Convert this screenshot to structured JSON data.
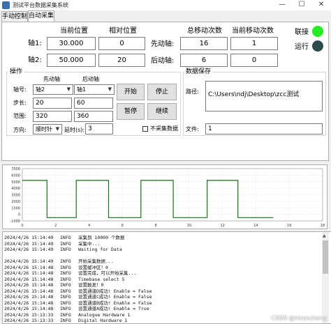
{
  "window": {
    "title": "测试平台数据采集系统",
    "minimize": "—",
    "maximize": "☐",
    "close": "✕"
  },
  "tabs": [
    {
      "label": "手动控制"
    },
    {
      "label": "自动采集"
    }
  ],
  "headers": {
    "current_pos": "当前位置",
    "relative_pos": "相对位置",
    "total_moves": "总移动次数",
    "current_moves": "当前移动次数"
  },
  "axis1": {
    "label": "轴1:",
    "current": "30.000",
    "relative": "0",
    "move_label": "先动轴:",
    "total": "16",
    "current_moves": "1"
  },
  "axis2": {
    "label": "轴2:",
    "current": "50.000",
    "relative": "20",
    "move_label": "后动轴:",
    "total": "6",
    "current_moves": "0"
  },
  "status": {
    "connect_label": "联接",
    "connect_color": "#22ee22",
    "run_label": "运行",
    "run_color": "#2b4a4a"
  },
  "operation": {
    "title": "操作",
    "col_first": "先动轴",
    "col_second": "后动轴",
    "axis_label": "轴号:",
    "axis_first": "轴2",
    "axis_second": "轴1",
    "step_label": "步长:",
    "step_first": "20",
    "step_second": "60",
    "range_label": "范围:",
    "range_first": "320",
    "range_second": "360",
    "dir_label": "方向:",
    "dir_value": "顺时针",
    "delay_label": "延时(s):",
    "delay_value": "3",
    "start": "开始",
    "stop": "停止",
    "pause": "暂停",
    "resume": "继续",
    "no_collect": "不采集数据"
  },
  "save": {
    "title": "数据保存",
    "path_label": "路径:",
    "path_value": "C:\\Users\\ndj\\Desktop\\zcc测试",
    "file_label": "文件:",
    "file_value": "1"
  },
  "chart_data": {
    "type": "line",
    "title": "",
    "series": [
      {
        "color": "#1f6b1f",
        "x": [
          0,
          0.5,
          1.6,
          1.6,
          3.5,
          3.5,
          5.6,
          5.6,
          7.7,
          7.7,
          9.8,
          9.8,
          12,
          12,
          14,
          14,
          16.3
        ],
        "y": [
          5200,
          5200,
          5200,
          -500,
          -500,
          5200,
          5200,
          -500,
          -500,
          5200,
          5200,
          -500,
          -500,
          5200,
          5200,
          -500,
          -500
        ]
      }
    ],
    "xlim": [
      0,
      19.5
    ],
    "ylim": [
      -1000,
      7000
    ],
    "yticks": [
      "7000",
      "6000",
      "5000",
      "4000",
      "3000",
      "2000",
      "1000",
      "0",
      "-1000"
    ],
    "xticks": [
      "0",
      "2",
      "4",
      "6",
      "8",
      "10",
      "12",
      "14",
      "16",
      "18"
    ],
    "grid": true
  },
  "log": [
    [
      "2024/4/26 15:14:49",
      "INFO",
      "采集到 10000 个数据"
    ],
    [
      "2024/4/26 15:14:49",
      "INFO",
      "采集中..."
    ],
    [
      "2024/4/26 15:14:49",
      "INFO",
      "Waiting for Data"
    ],
    [
      "",
      "",
      ""
    ],
    [
      "2024/4/26 15:14:49",
      "INFO",
      "开始采集数据..."
    ],
    [
      "2024/4/26 15:14:48",
      "INFO",
      "设置缓冲区！0"
    ],
    [
      "2024/4/26 15:14:48",
      "INFO",
      "设置完成，可以开始采集..."
    ],
    [
      "2024/4/26 15:14:48",
      "INFO",
      "Timebase select 5"
    ],
    [
      "2024/4/26 15:14:48",
      "INFO",
      "设置触发！0"
    ],
    [
      "2024/4/26 15:14:48",
      "INFO",
      "设置通道D成功! Enable = False"
    ],
    [
      "2024/4/26 15:14:48",
      "INFO",
      "设置通道C成功! Enable = False"
    ],
    [
      "2024/4/26 15:14:48",
      "INFO",
      "设置通道B成功! Enable = False"
    ],
    [
      "2024/4/26 15:14:48",
      "INFO",
      "设置通道A成功! Enable = True"
    ],
    [
      "2024/4/26 15:13:33",
      "INFO",
      "Analogue Hardware 1"
    ],
    [
      "2024/4/26 15:13:33",
      "INFO",
      "Digital Hardware 1"
    ]
  ],
  "watermark": "CSDN @nixoncheng"
}
